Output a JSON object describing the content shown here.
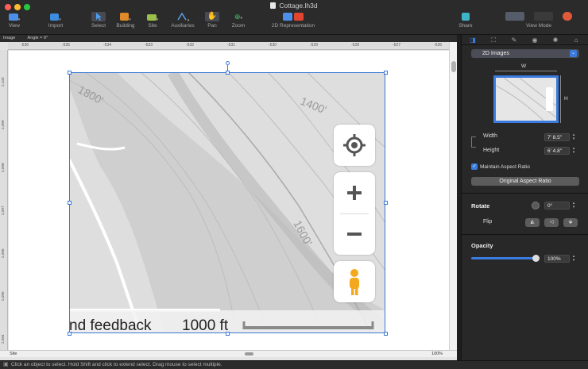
{
  "window": {
    "title": "Cottage.lh3d"
  },
  "toolbar": {
    "view": "View",
    "import": "Import",
    "select": "Select",
    "building": "Building",
    "site": "Site",
    "auxiliaries": "Auxiliaries",
    "pan": "Pan",
    "zoom": "Zoom",
    "representation": "2D Representation",
    "share": "Share",
    "view_mode": "View Mode"
  },
  "infobar": {
    "object": "Image",
    "angle": "Angle = 0°"
  },
  "ruler_top": [
    "-536",
    "-535",
    "-534",
    "-533",
    "-532",
    "-531",
    "-530",
    "-529",
    "-528",
    "-527",
    "-526"
  ],
  "ruler_left": [
    "2,100",
    "2,099",
    "2,098",
    "2,097",
    "2,096",
    "2,095",
    "2,094"
  ],
  "map": {
    "contours": [
      "1800'",
      "1400'",
      "1600'"
    ],
    "footer_feedback": "nd feedback",
    "footer_scale": "1000 ft"
  },
  "bottombar": {
    "layer": "Site",
    "zoom": "100%"
  },
  "status": "Click an object to select. Hold Shift and click to extend select. Drag mouse to select multiple.",
  "panel": {
    "category": "2D Images",
    "thumb_w": "W",
    "thumb_h": "H",
    "width_label": "Width",
    "width_value": "7' 8.5\"",
    "height_label": "Height",
    "height_value": "6' 4.8\"",
    "maintain_label": "Maintain Aspect Ratio",
    "maintain_checked": true,
    "original_button": "Original Aspect Ratio",
    "rotate_label": "Rotate",
    "rotate_value": "0°",
    "flip_label": "Flip",
    "opacity_label": "Opacity",
    "opacity_value": "100%",
    "opacity_level": 1.0
  },
  "colors": {
    "accent": "#3b7be0",
    "toolbar": "#2b2b2b",
    "panel": "#282828",
    "canvas": "#e4e4e4"
  }
}
